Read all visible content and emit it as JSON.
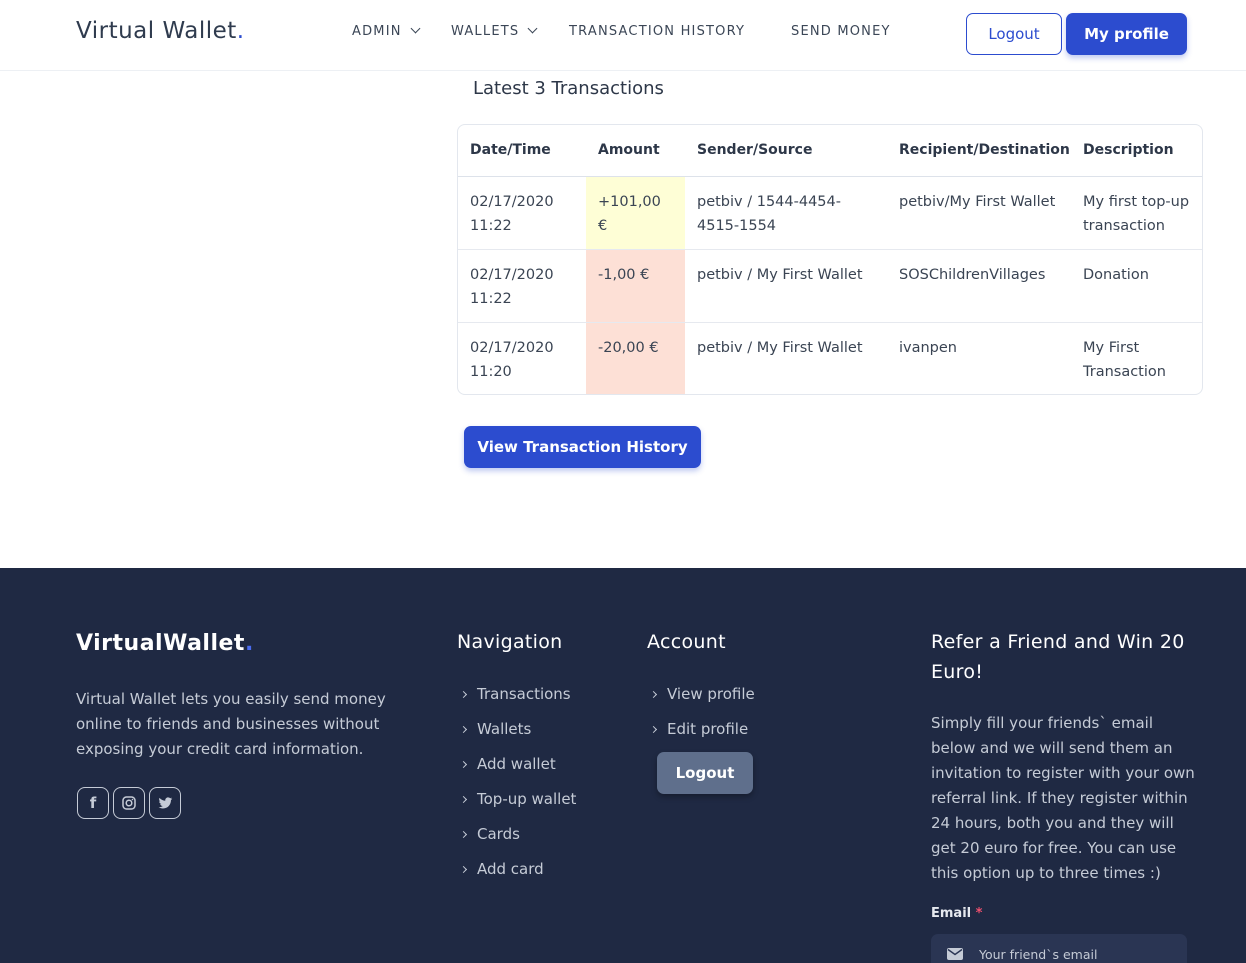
{
  "header": {
    "brand": "Virtual Wallet",
    "brand_dot": ".",
    "nav": [
      {
        "label": "ADMIN",
        "has_dropdown": true
      },
      {
        "label": "WALLETS",
        "has_dropdown": true
      },
      {
        "label": "TRANSACTION HISTORY",
        "has_dropdown": false
      },
      {
        "label": "SEND MONEY",
        "has_dropdown": false
      }
    ],
    "logout_label": "Logout",
    "profile_label": "My profile"
  },
  "transactions": {
    "title": "Latest 3 Transactions",
    "columns": [
      "Date/Time",
      "Amount",
      "Sender/Source",
      "Recipient/Destination",
      "Description"
    ],
    "rows": [
      {
        "date": "02/17/2020",
        "time": "11:22",
        "amount": "+101,00 €",
        "amount_type": "positive",
        "sender": "petbiv / 1544-4454-4515-1554",
        "recipient": "petbiv/My First Wallet",
        "description": "My first top-up transaction"
      },
      {
        "date": "02/17/2020",
        "time": "11:22",
        "amount": "-1,00 €",
        "amount_type": "negative",
        "sender": "petbiv / My First Wallet",
        "recipient": "SOSChildrenVillages",
        "description": "Donation"
      },
      {
        "date": "02/17/2020",
        "time": "11:20",
        "amount": "-20,00 €",
        "amount_type": "negative",
        "sender": "petbiv / My First Wallet",
        "recipient": "ivanpen",
        "description": "My First Transaction"
      }
    ],
    "view_history_label": "View Transaction History"
  },
  "footer": {
    "brand": "VirtualWallet",
    "brand_dot": ".",
    "about": "Virtual Wallet lets you easily send money online to friends and businesses without exposing your credit card information.",
    "social": [
      {
        "icon": "facebook-icon",
        "glyph": "f"
      },
      {
        "icon": "instagram-icon",
        "glyph": ""
      },
      {
        "icon": "twitter-icon",
        "glyph": ""
      }
    ],
    "navigation_title": "Navigation",
    "navigation": [
      "Transactions",
      "Wallets",
      "Add wallet",
      "Top-up wallet",
      "Cards",
      "Add card"
    ],
    "account_title": "Account",
    "account": [
      "View profile",
      "Edit profile"
    ],
    "logout_label": "Logout",
    "refer_title": "Refer a Friend and Win 20 Euro!",
    "refer_text": "Simply fill your friends` email below and we will send them an invitation to register with your own referral link. If they register within 24 hours, both you and they will get 20 euro for free. You can use this option up to three times :)",
    "email_label": "Email",
    "email_required": "*",
    "email_placeholder": "Your friend`s email"
  },
  "colors": {
    "primary": "#2c4ccf",
    "footer_bg": "#1f2943",
    "positive_amount_bg": "#fefed6",
    "negative_amount_bg": "#fde0d6"
  }
}
